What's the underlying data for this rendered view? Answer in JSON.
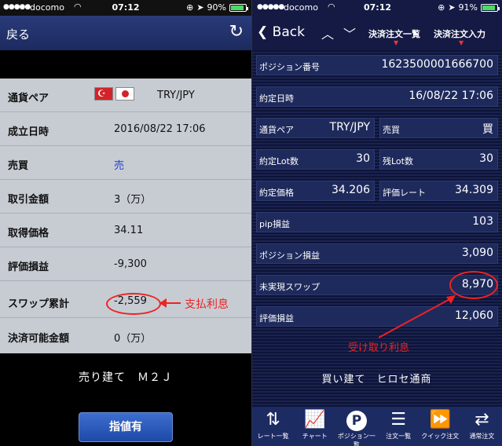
{
  "left": {
    "status": {
      "signal": "●●●●●",
      "carrier": "docomo",
      "time": "07:12",
      "battery": "90%",
      "battery_level": 0.9
    },
    "nav": {
      "back_label": "戻る",
      "refresh_icon": "refresh-icon"
    },
    "rows": [
      {
        "label": "通貨ペア",
        "value": "TRY/JPY"
      },
      {
        "label": "成立日時",
        "value": "2016/08/22 17:06"
      },
      {
        "label": "売買",
        "value": "売"
      },
      {
        "label": "取引金額",
        "value": "3（万）"
      },
      {
        "label": "取得価格",
        "value": "34.11"
      },
      {
        "label": "評価損益",
        "value": "-9,300"
      },
      {
        "label": "スワップ累計",
        "value": "-2,559"
      },
      {
        "label": "決済可能金額",
        "value": "0（万）"
      }
    ],
    "annotation": "支払利息",
    "position_text": "売り建て　Ｍ２Ｊ",
    "limit_button_label": "指値有",
    "colors": {
      "sell": "#1d3fd6",
      "annotation": "#e22222"
    }
  },
  "right": {
    "status": {
      "signal": "●●●●●",
      "carrier": "docomo",
      "time": "07:12",
      "battery": "91%",
      "battery_level": 0.91
    },
    "nav": {
      "back_label": "Back",
      "tab1": "決済注文一覧",
      "tab2": "決済注文入力"
    },
    "fields": {
      "position_no": {
        "label": "ポジション番号",
        "value": "1623500001666700"
      },
      "contract_date": {
        "label": "約定日時",
        "value": "16/08/22 17:06"
      },
      "pair": {
        "label": "通貨ペア",
        "value": "TRY/JPY"
      },
      "side": {
        "label": "売買",
        "value": "買"
      },
      "contract_lots": {
        "label": "約定Lot数",
        "value": "30"
      },
      "remaining_lots": {
        "label": "残Lot数",
        "value": "30"
      },
      "contract_price": {
        "label": "約定価格",
        "value": "34.206"
      },
      "valuation_rate": {
        "label": "評価レート",
        "value": "34.309"
      },
      "pip_pl": {
        "label": "pip損益",
        "value": "103"
      },
      "position_pl": {
        "label": "ポジション損益",
        "value": "3,090"
      },
      "unrealized_swap": {
        "label": "未実現スワップ",
        "value": "8,970"
      },
      "valuation_pl": {
        "label": "評価損益",
        "value": "12,060"
      }
    },
    "annotation": "受け取り利息",
    "position_text": "買い建て　ヒロセ通商",
    "tabbar": [
      {
        "label": "レート一覧",
        "icon": "rate-list-icon"
      },
      {
        "label": "チャート",
        "icon": "chart-icon"
      },
      {
        "label": "ポジション一覧",
        "icon": "position-list-icon"
      },
      {
        "label": "注文一覧",
        "icon": "order-list-icon"
      },
      {
        "label": "クイック注文",
        "icon": "quick-order-icon"
      },
      {
        "label": "通常注文",
        "icon": "normal-order-icon"
      }
    ]
  }
}
